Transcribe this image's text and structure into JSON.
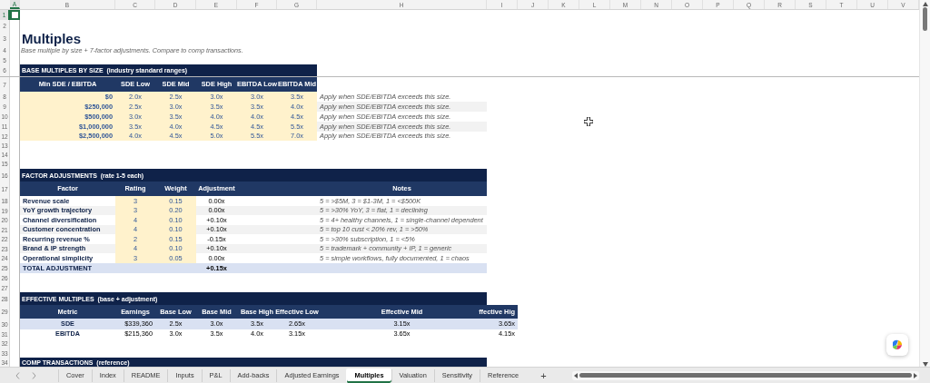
{
  "column_headers": [
    {
      "label": "A",
      "selected": true
    },
    {
      "label": "B",
      "selected": false
    },
    {
      "label": "C",
      "selected": false
    },
    {
      "label": "D",
      "selected": false
    },
    {
      "label": "E",
      "selected": false
    },
    {
      "label": "F",
      "selected": false
    },
    {
      "label": "G",
      "selected": false
    },
    {
      "label": "H",
      "selected": false
    },
    {
      "label": "I",
      "selected": false
    },
    {
      "label": "J",
      "selected": false
    },
    {
      "label": "K",
      "selected": false
    },
    {
      "label": "L",
      "selected": false
    },
    {
      "label": "M",
      "selected": false
    },
    {
      "label": "N",
      "selected": false
    },
    {
      "label": "O",
      "selected": false
    },
    {
      "label": "P",
      "selected": false
    },
    {
      "label": "Q",
      "selected": false
    },
    {
      "label": "R",
      "selected": false
    },
    {
      "label": "S",
      "selected": false
    },
    {
      "label": "T",
      "selected": false
    },
    {
      "label": "U",
      "selected": false
    },
    {
      "label": "V",
      "selected": false
    }
  ],
  "row_numbers": [
    {
      "label": "1",
      "selected": true
    },
    {
      "label": "2",
      "selected": false
    },
    {
      "label": "3",
      "selected": false
    },
    {
      "label": "4",
      "selected": false
    },
    {
      "label": "5",
      "selected": false
    },
    {
      "label": "6",
      "selected": false
    },
    {
      "label": "7",
      "selected": false
    },
    {
      "label": "8",
      "selected": false
    },
    {
      "label": "9",
      "selected": false
    },
    {
      "label": "10",
      "selected": false
    },
    {
      "label": "11",
      "selected": false
    },
    {
      "label": "12",
      "selected": false
    },
    {
      "label": "13",
      "selected": false
    },
    {
      "label": "14",
      "selected": false
    },
    {
      "label": "15",
      "selected": false
    },
    {
      "label": "16",
      "selected": false
    },
    {
      "label": "17",
      "selected": false
    },
    {
      "label": "18",
      "selected": false
    },
    {
      "label": "19",
      "selected": false
    },
    {
      "label": "20",
      "selected": false
    },
    {
      "label": "21",
      "selected": false
    },
    {
      "label": "22",
      "selected": false
    },
    {
      "label": "23",
      "selected": false
    },
    {
      "label": "24",
      "selected": false
    },
    {
      "label": "25",
      "selected": false
    },
    {
      "label": "26",
      "selected": false
    },
    {
      "label": "27",
      "selected": false
    },
    {
      "label": "28",
      "selected": false
    },
    {
      "label": "29",
      "selected": false
    },
    {
      "label": "30",
      "selected": false
    },
    {
      "label": "31",
      "selected": false
    },
    {
      "label": "32",
      "selected": false
    },
    {
      "label": "33",
      "selected": false
    },
    {
      "label": "34",
      "selected": false
    }
  ],
  "title": "Multiples",
  "subtitle": "Base multiple by size + 7-factor adjustments. Compare to comp transactions.",
  "base_multiples": {
    "title": "BASE MULTIPLES BY SIZE  (industry standard ranges)",
    "columns": [
      "Min SDE / EBITDA",
      "SDE Low",
      "SDE Mid",
      "SDE High",
      "EBITDA Low",
      "EBITDA Mid"
    ],
    "rows": [
      {
        "min": "$0",
        "values": [
          "2.0x",
          "2.5x",
          "3.0x",
          "3.0x",
          "3.5x"
        ],
        "note": "Apply when SDE/EBITDA exceeds this size."
      },
      {
        "min": "$250,000",
        "values": [
          "2.5x",
          "3.0x",
          "3.5x",
          "3.5x",
          "4.0x"
        ],
        "note": "Apply when SDE/EBITDA exceeds this size."
      },
      {
        "min": "$500,000",
        "values": [
          "3.0x",
          "3.5x",
          "4.0x",
          "4.0x",
          "4.5x"
        ],
        "note": "Apply when SDE/EBITDA exceeds this size."
      },
      {
        "min": "$1,000,000",
        "values": [
          "3.5x",
          "4.0x",
          "4.5x",
          "4.5x",
          "5.5x"
        ],
        "note": "Apply when SDE/EBITDA exceeds this size."
      },
      {
        "min": "$2,500,000",
        "values": [
          "4.0x",
          "4.5x",
          "5.0x",
          "5.5x",
          "7.0x"
        ],
        "note": "Apply when SDE/EBITDA exceeds this size."
      }
    ]
  },
  "factor_adjustments": {
    "title": "FACTOR ADJUSTMENTS  (rate 1-5 each)",
    "columns": [
      "Factor",
      "Rating",
      "Weight",
      "Adjustment",
      "Notes"
    ],
    "rows": [
      {
        "factor": "Revenue scale",
        "rating": "3",
        "weight": "0.15",
        "adjustment": "0.00x",
        "notes": "5 = >$5M, 3 = $1-3M, 1 = <$500K"
      },
      {
        "factor": "YoY growth trajectory",
        "rating": "3",
        "weight": "0.20",
        "adjustment": "0.00x",
        "notes": "5 = >30% YoY, 3 = flat, 1 = declining"
      },
      {
        "factor": "Channel diversification",
        "rating": "4",
        "weight": "0.10",
        "adjustment": "+0.10x",
        "notes": "5 = 4+ healthy channels, 1 = single-channel dependent"
      },
      {
        "factor": "Customer concentration",
        "rating": "4",
        "weight": "0.10",
        "adjustment": "+0.10x",
        "notes": "5 = top 10 cust < 20% rev, 1 = >50%"
      },
      {
        "factor": "Recurring revenue %",
        "rating": "2",
        "weight": "0.15",
        "adjustment": "-0.15x",
        "notes": "5 = >30% subscription, 1 = <5%"
      },
      {
        "factor": "Brand & IP strength",
        "rating": "4",
        "weight": "0.10",
        "adjustment": "+0.10x",
        "notes": "5 = trademark + community + IP, 1 = generic"
      },
      {
        "factor": "Operational simplicity",
        "rating": "3",
        "weight": "0.05",
        "adjustment": "0.00x",
        "notes": "5 = simple workflows, fully documented, 1 = chaos"
      }
    ],
    "total": {
      "label": "TOTAL ADJUSTMENT",
      "value": "+0.15x"
    }
  },
  "effective_multiples": {
    "title": "EFFECTIVE MULTIPLES  (base + adjustment)",
    "columns": [
      "Metric",
      "Earnings",
      "Base Low",
      "Base Mid",
      "Base High",
      "Effective Low",
      "Effective Mid",
      "ffective Hig"
    ],
    "rows": [
      {
        "metric": "SDE",
        "values": [
          "$339,360",
          "2.5x",
          "3.0x",
          "3.5x",
          "2.65x",
          "3.15x",
          "3.65x"
        ]
      },
      {
        "metric": "EBITDA",
        "values": [
          "$215,360",
          "3.0x",
          "3.5x",
          "4.0x",
          "3.15x",
          "3.65x",
          "4.15x"
        ]
      }
    ]
  },
  "comp_transactions": {
    "title": "COMP TRANSACTIONS  (reference)"
  },
  "sheet_tabs": [
    {
      "label": "Cover",
      "selected": false
    },
    {
      "label": "Index",
      "selected": false
    },
    {
      "label": "README",
      "selected": false
    },
    {
      "label": "Inputs",
      "selected": false
    },
    {
      "label": "P&L",
      "selected": false
    },
    {
      "label": "Add-backs",
      "selected": false
    },
    {
      "label": "Adjusted Earnings",
      "selected": false
    },
    {
      "label": "Multiples",
      "selected": true
    },
    {
      "label": "Valuation",
      "selected": false
    },
    {
      "label": "Sensitivity",
      "selected": false
    },
    {
      "label": "Reference",
      "selected": false
    }
  ],
  "add_sheet": "+"
}
